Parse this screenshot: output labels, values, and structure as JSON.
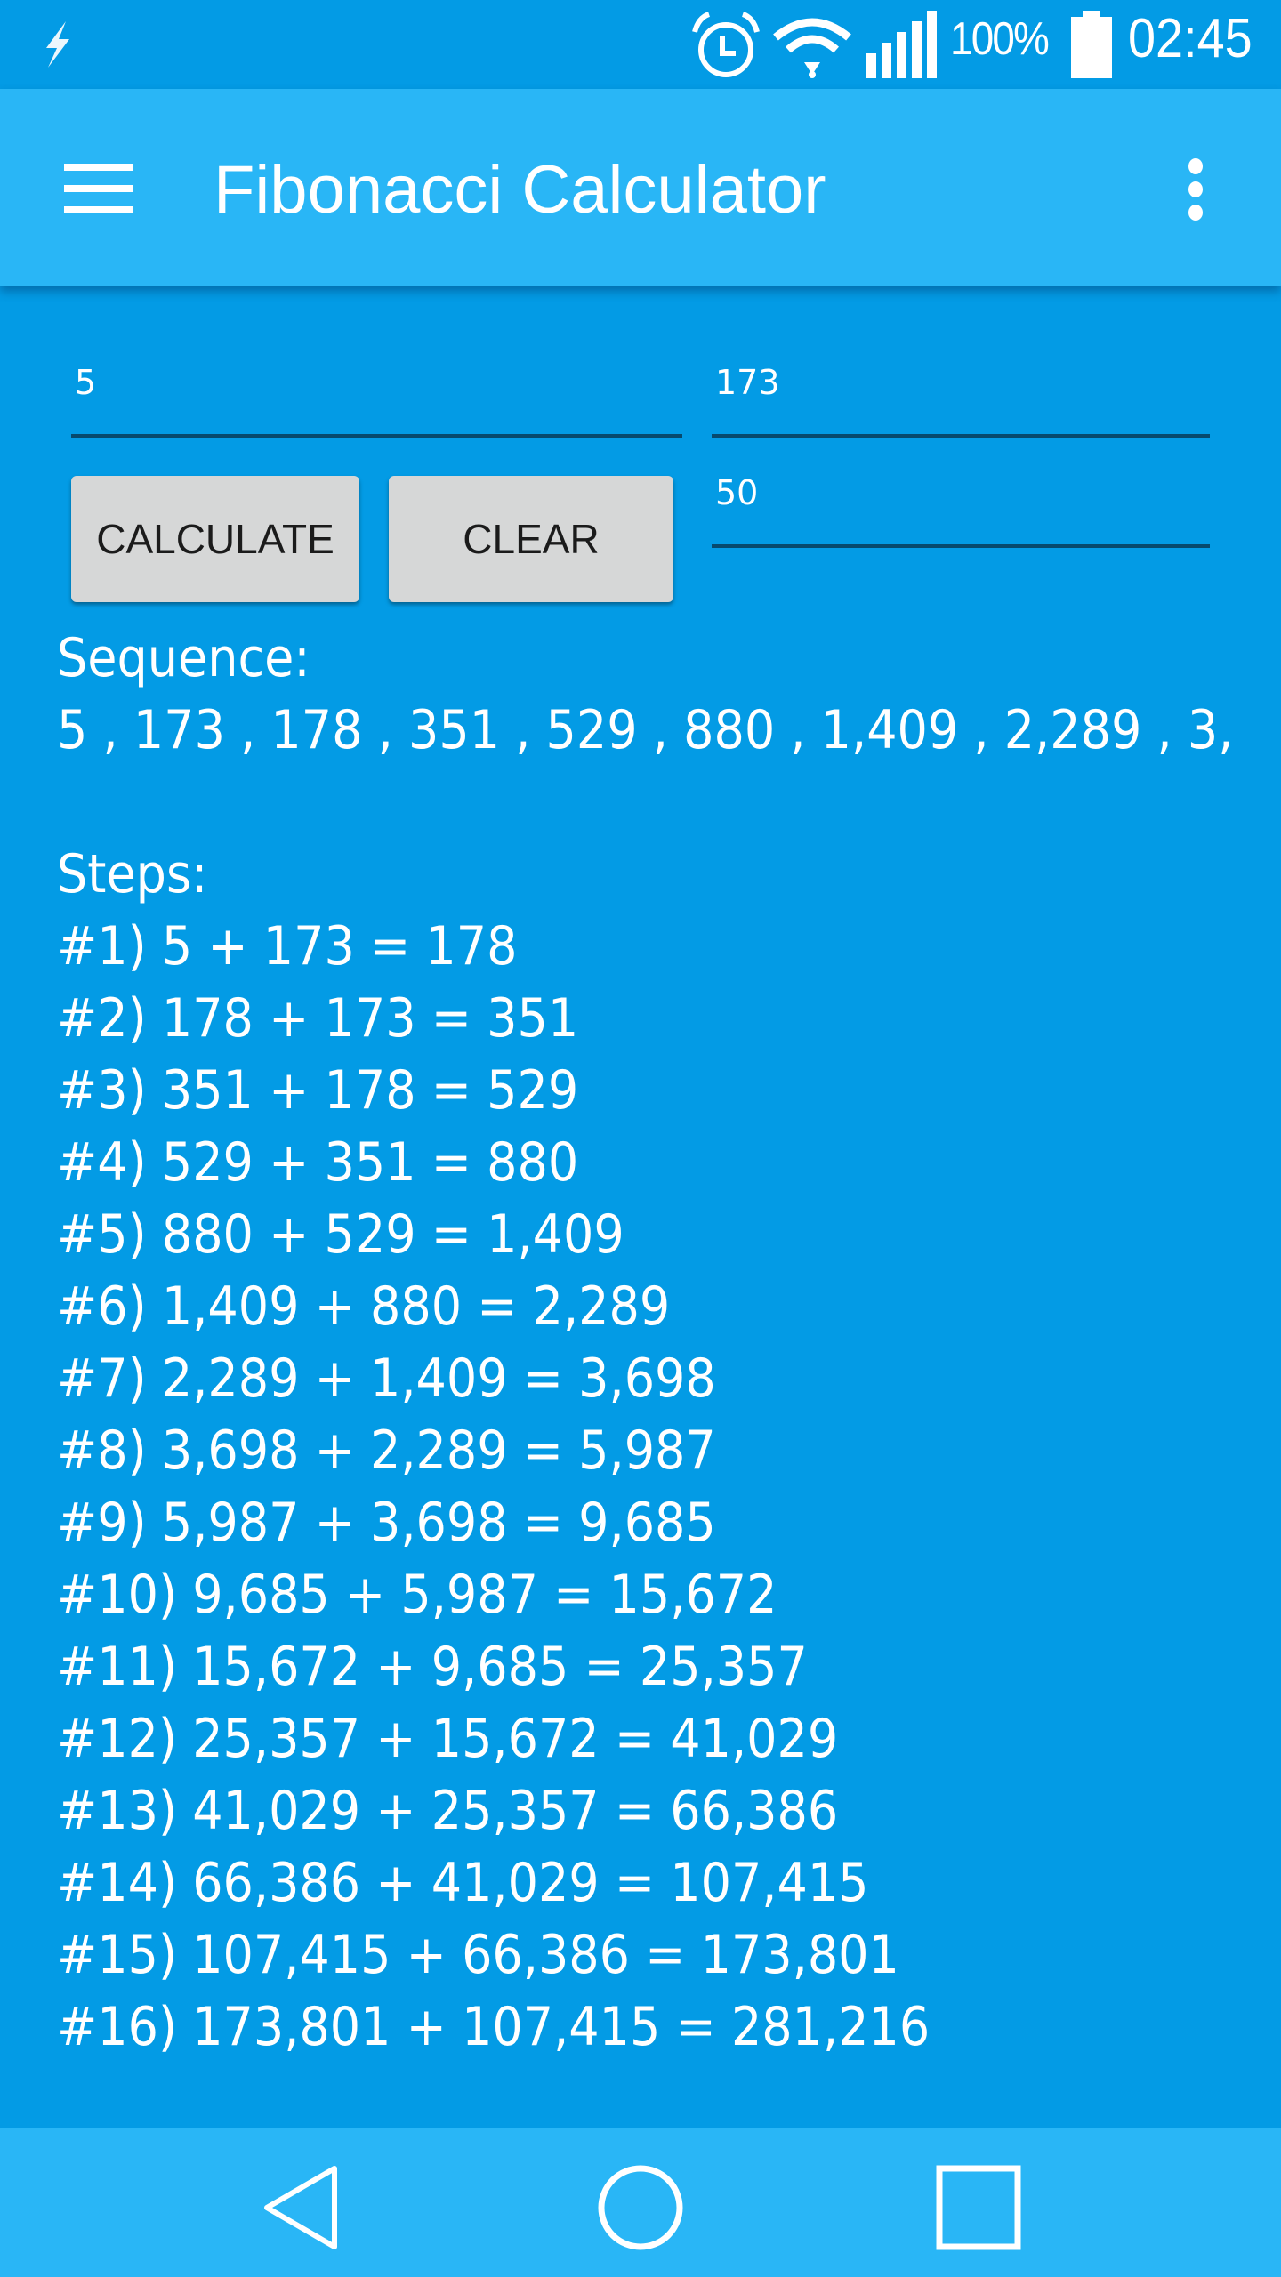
{
  "status_bar": {
    "left_icon": "flash-icon",
    "icons": [
      "alarm-icon",
      "wifi-icon",
      "signal-icon",
      "battery-icon"
    ],
    "battery_percent": "100%",
    "time": "02:45"
  },
  "app_bar": {
    "nav_icon": "hamburger-menu-icon",
    "title": "Fibonacci Calculator",
    "overflow_icon": "more-vert-icon"
  },
  "form": {
    "first_number": "5",
    "second_number": "173",
    "step_count": "50",
    "calculate_label": "CALCULATE",
    "clear_label": "CLEAR"
  },
  "results": {
    "sequence_label": "Sequence:",
    "sequence_text": "5 , 173 , 178 , 351 , 529 , 880 , 1,409 , 2,289 , 3,",
    "steps_label": "Steps:",
    "steps": [
      "#1) 5 + 173 = 178",
      "#2) 178 + 173 = 351",
      "#3) 351 + 178 = 529",
      "#4) 529 + 351 = 880",
      "#5) 880 + 529 = 1,409",
      "#6) 1,409 + 880 = 2,289",
      "#7) 2,289 + 1,409 = 3,698",
      "#8) 3,698 + 2,289 = 5,987",
      "#9) 5,987 + 3,698 = 9,685",
      "#10) 9,685 + 5,987 = 15,672",
      "#11) 15,672 + 9,685 = 25,357",
      "#12) 25,357 + 15,672 = 41,029",
      "#13) 41,029 + 25,357 = 66,386",
      "#14) 66,386 + 41,029 = 107,415",
      "#15) 107,415 + 66,386 = 173,801",
      "#16) 173,801 + 107,415 = 281,216"
    ]
  },
  "nav_bar": {
    "back_icon": "back-icon",
    "home_icon": "home-icon",
    "recents_icon": "recents-icon"
  },
  "colors": {
    "primary_dark": "#039BE5",
    "primary": "#29B6F6",
    "button_bg": "#D6D7D7",
    "underline": "#074A6E"
  }
}
